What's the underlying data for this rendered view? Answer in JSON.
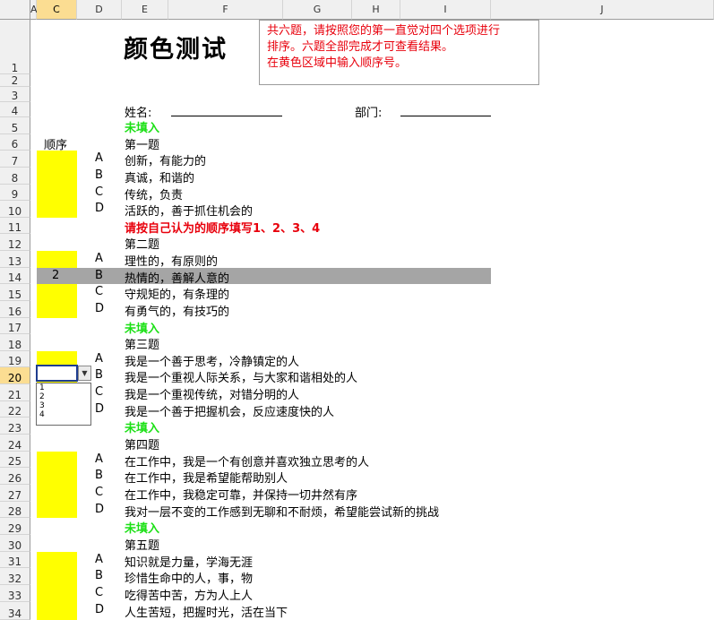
{
  "columns": [
    "A",
    "C",
    "D",
    "E",
    "F",
    "G",
    "H",
    "I",
    "J"
  ],
  "selected_column": "C",
  "selected_row": "20",
  "title": "颜色测试",
  "note": [
    "共六题，请按照您的第一直觉对四个选项进行",
    "排序。六题全部完成才可查看结果。",
    "在黄色区域中输入顺序号。"
  ],
  "name_label": "姓名:",
  "dept_label": "部门:",
  "order_header": "顺序",
  "status_unfilled": "未填入",
  "instruction": "请按自己认为的顺序填写1、2、3、4",
  "highlighted_value": "2",
  "dropdown_options": [
    "1",
    "2",
    "3",
    "4"
  ],
  "rows": [
    {
      "n": "1"
    },
    {
      "n": "2"
    },
    {
      "n": "3"
    },
    {
      "n": "4"
    },
    {
      "n": "5"
    },
    {
      "n": "6"
    },
    {
      "n": "7"
    },
    {
      "n": "8"
    },
    {
      "n": "9"
    },
    {
      "n": "10"
    },
    {
      "n": "11"
    },
    {
      "n": "12"
    },
    {
      "n": "13"
    },
    {
      "n": "14"
    },
    {
      "n": "15"
    },
    {
      "n": "16"
    },
    {
      "n": "17"
    },
    {
      "n": "18"
    },
    {
      "n": "19"
    },
    {
      "n": "20"
    },
    {
      "n": "21"
    },
    {
      "n": "22"
    },
    {
      "n": "23"
    },
    {
      "n": "24"
    },
    {
      "n": "25"
    },
    {
      "n": "26"
    },
    {
      "n": "27"
    },
    {
      "n": "28"
    },
    {
      "n": "29"
    },
    {
      "n": "30"
    },
    {
      "n": "31"
    },
    {
      "n": "32"
    },
    {
      "n": "33"
    },
    {
      "n": "34"
    }
  ],
  "questions": [
    {
      "title": "第一题",
      "options": [
        [
          "A",
          "创新，有能力的"
        ],
        [
          "B",
          "真诚，和谐的"
        ],
        [
          "C",
          "传统，负责"
        ],
        [
          "D",
          "活跃的，善于抓住机会的"
        ]
      ]
    },
    {
      "title": "第二题",
      "options": [
        [
          "A",
          "理性的，有原则的"
        ],
        [
          "B",
          "热情的，善解人意的"
        ],
        [
          "C",
          "守规矩的，有条理的"
        ],
        [
          "D",
          "有勇气的，有技巧的"
        ]
      ]
    },
    {
      "title": "第三题",
      "options": [
        [
          "A",
          "我是一个善于思考，冷静镇定的人"
        ],
        [
          "B",
          "我是一个重视人际关系，与大家和谐相处的人"
        ],
        [
          "C",
          "我是一个重视传统，对错分明的人"
        ],
        [
          "D",
          "我是一个善于把握机会，反应速度快的人"
        ]
      ]
    },
    {
      "title": "第四题",
      "options": [
        [
          "A",
          "在工作中，我是一个有创意并喜欢独立思考的人"
        ],
        [
          "B",
          "在工作中，我是希望能帮助别人"
        ],
        [
          "C",
          "在工作中，我稳定可靠，并保持一切井然有序"
        ],
        [
          "D",
          "我对一层不变的工作感到无聊和不耐烦，希望能尝试新的挑战"
        ]
      ]
    },
    {
      "title": "第五题",
      "options": [
        [
          "A",
          "知识就是力量，学海无涯"
        ],
        [
          "B",
          "珍惜生命中的人，事，物"
        ],
        [
          "C",
          "吃得苦中苦，方为人上人"
        ],
        [
          "D",
          "人生苦短，把握时光，活在当下"
        ]
      ]
    }
  ]
}
